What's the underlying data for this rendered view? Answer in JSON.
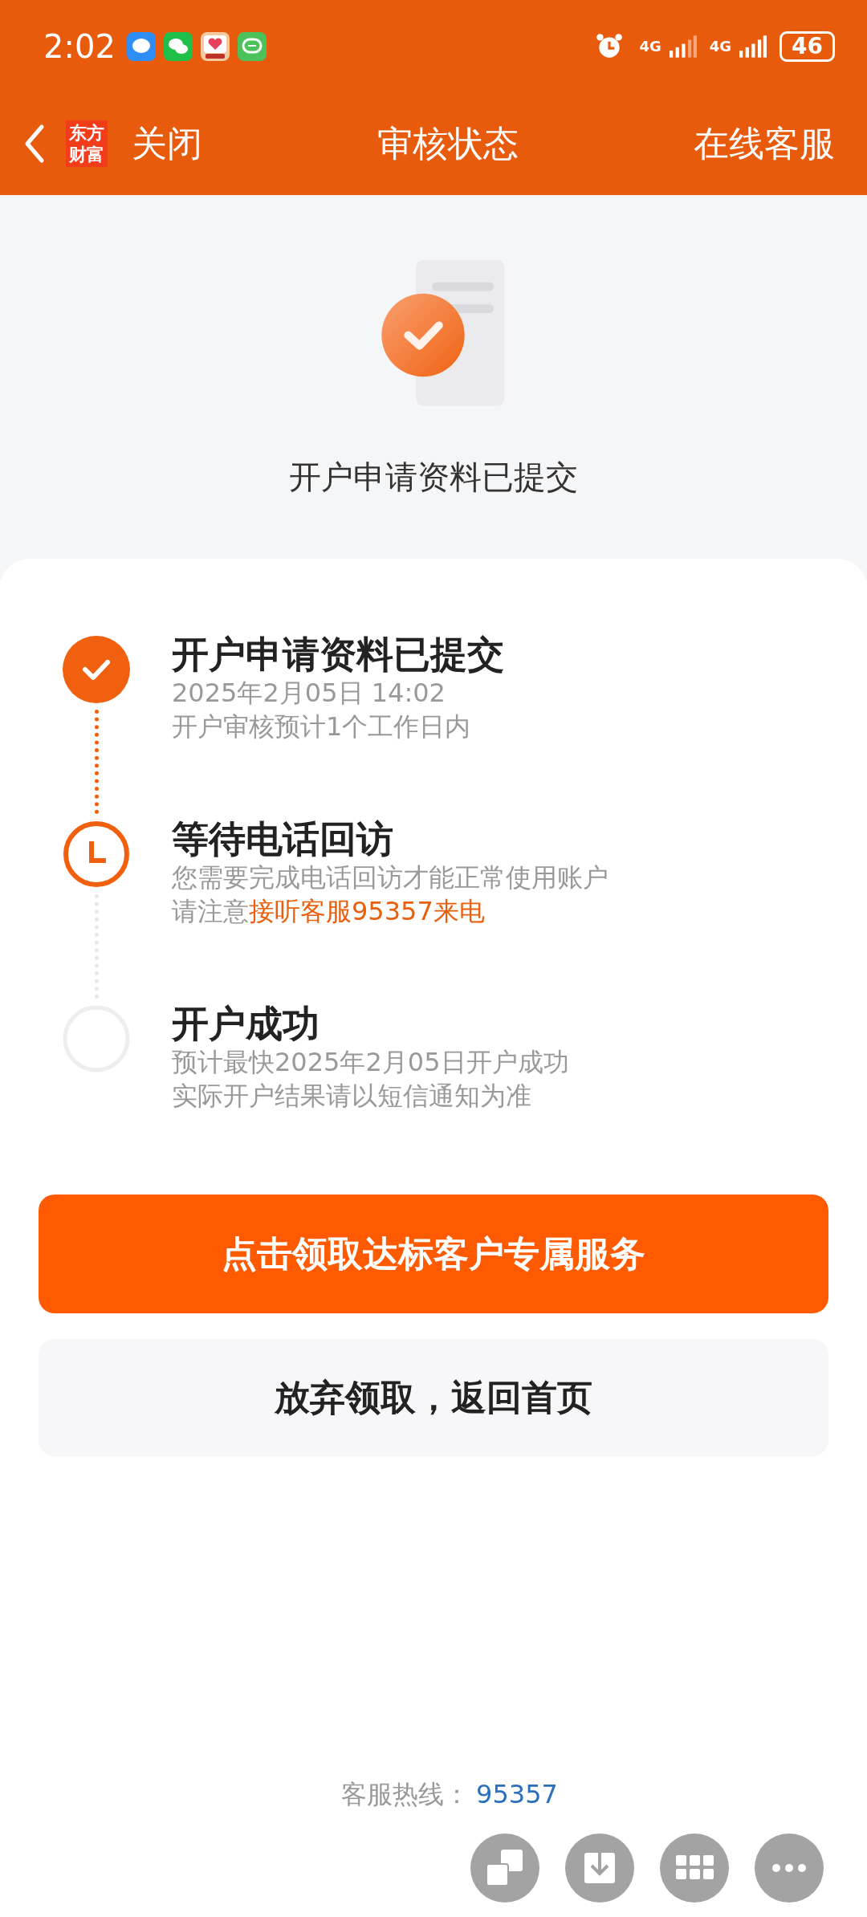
{
  "status_bar": {
    "time": "2:02",
    "notifications": [
      {
        "kind": "message"
      },
      {
        "kind": "wechat"
      },
      {
        "kind": "app"
      },
      {
        "kind": "chat"
      }
    ],
    "network_1": "4G",
    "network_2": "4G",
    "battery": "46"
  },
  "header": {
    "logo": [
      "东方",
      "财富"
    ],
    "close": "关闭",
    "title": "审核状态",
    "service": "在线客服"
  },
  "hero": {
    "caption": "开户申请资料已提交"
  },
  "steps": [
    {
      "kind": "done",
      "title": "开户申请资料已提交",
      "lines": [
        {
          "text": "2025年2月05日 14:02"
        },
        {
          "text": "开户审核预计1个工作日内"
        }
      ]
    },
    {
      "kind": "current",
      "title": "等待电话回访",
      "lines": [
        {
          "text": "您需要完成电话回访才能正常使用账户"
        },
        {
          "text": "请注意",
          "highlight": "接听客服95357来电"
        }
      ]
    },
    {
      "kind": "pending",
      "title": "开户成功",
      "lines": [
        {
          "text": "预计最快2025年2月05日开户成功"
        },
        {
          "text": "实际开户结果请以短信通知为准"
        }
      ]
    }
  ],
  "primary_button": "点击领取达标客户专属服务",
  "secondary_button": "放弃领取，返回首页",
  "hotline": {
    "label": "客服热线：",
    "number": "95357"
  },
  "floating_buttons": [
    {
      "kind": "translate"
    },
    {
      "kind": "download"
    },
    {
      "kind": "apps"
    },
    {
      "kind": "more"
    }
  ]
}
